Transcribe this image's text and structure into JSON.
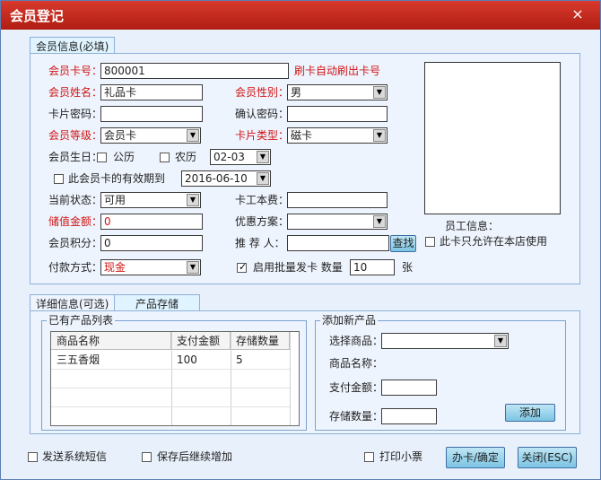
{
  "window": {
    "title": "会员登记",
    "close_label": "×"
  },
  "tabs": {
    "member_info": "会员信息(必填)",
    "detail_info": "详细信息(可选)",
    "product_storage": "产品存储"
  },
  "form": {
    "card_no_label": "会员卡号：",
    "card_no_value": "800001",
    "swipe_hint": "刷卡自动刷出卡号",
    "name_label": "会员姓名：",
    "name_value": "礼品卡",
    "gender_label": "会员性别：",
    "gender_value": "男",
    "password_label": "卡片密码：",
    "confirm_label": "确认密码：",
    "level_label": "会员等级：",
    "level_value": "会员卡",
    "card_type_label": "卡片类型：",
    "card_type_value": "磁卡",
    "birthday_label": "会员生日：",
    "solar_label": "公历",
    "lunar_label": "农历",
    "birthday_value": "02-03",
    "expiry_label": "此会员卡的有效期到",
    "expiry_value": "2016-06-10",
    "status_label": "当前状态：",
    "status_value": "可用",
    "card_fee_label": "卡工本费：",
    "stored_label": "储值金额：",
    "stored_value": "0",
    "discount_label": "优惠方案：",
    "points_label": "会员积分：",
    "points_value": "0",
    "referrer_label": "推 荐 人：",
    "search_button": "查找",
    "payment_label": "付款方式：",
    "payment_value": "现金",
    "batch_label": "启用批量发卡  数量",
    "batch_qty": "10",
    "batch_unit": "张",
    "staff_label": "员工信息：",
    "store_only_label": "此卡只允许在本店使用"
  },
  "products": {
    "list_title": "已有产品列表",
    "columns": [
      "商品名称",
      "支付金额",
      "存储数量"
    ],
    "rows": [
      {
        "name": "三五香烟",
        "amount": "100",
        "qty": "5"
      }
    ],
    "add_title": "添加新产品",
    "select_label": "选择商品：",
    "name_label": "商品名称：",
    "amount_label": "支付金额：",
    "qty_label": "存储数量：",
    "add_button": "添加"
  },
  "footer": {
    "sms_label": "发送系统短信",
    "continue_label": "保存后继续增加",
    "print_label": "打印小票",
    "confirm_button": "办卡/确定",
    "close_button": "关闭(ESC)"
  }
}
